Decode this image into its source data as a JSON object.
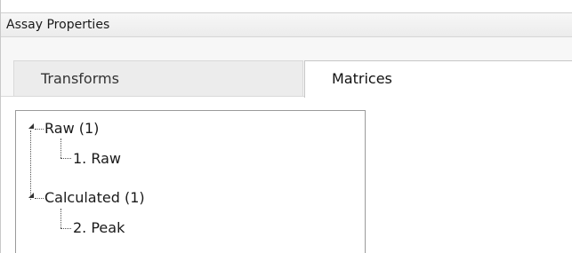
{
  "window": {
    "title": "Assay Properties"
  },
  "tabs": [
    {
      "label": "Transforms",
      "selected": false
    },
    {
      "label": "Matrices",
      "selected": true
    }
  ],
  "tree": {
    "nodes": [
      {
        "label": "Raw (1)",
        "expanded": true,
        "children": [
          {
            "label": "1. Raw"
          }
        ]
      },
      {
        "label": "Calculated (1)",
        "expanded": true,
        "children": [
          {
            "label": "2. Peak"
          }
        ]
      }
    ]
  },
  "colors": {
    "selected_tab_bg": "#ffffff",
    "unselected_tab_bg": "#ececec",
    "tree_border": "#9a9a9a"
  }
}
